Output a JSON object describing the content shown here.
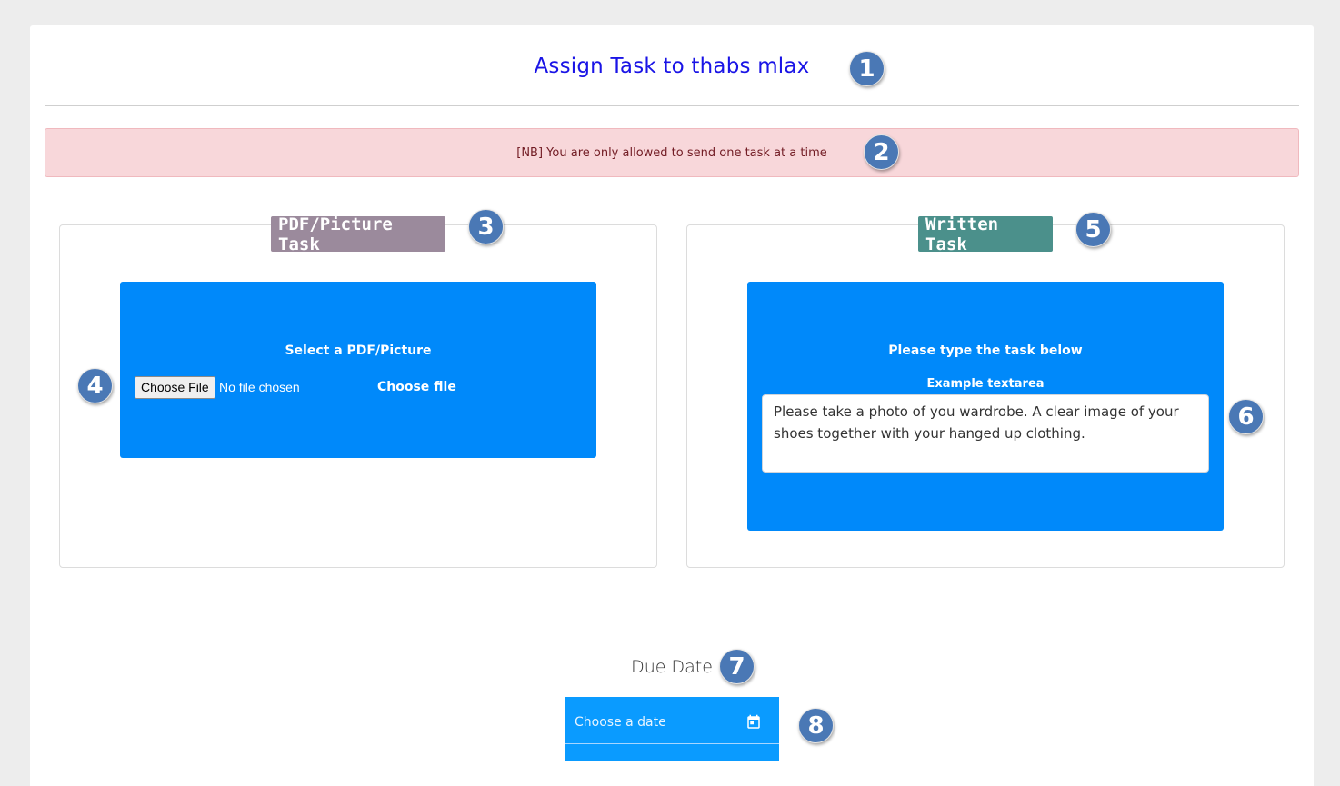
{
  "header": {
    "title": "Assign Task to thabs mlax"
  },
  "alert": {
    "text": "[NB] You are only allowed to send one task at a time"
  },
  "pdf_task": {
    "chip_label": "PDF/Picture Task",
    "heading": "Select a PDF/Picture",
    "file_button_label": "Choose File",
    "file_status": "No file chosen",
    "choose_file_label": "Choose file"
  },
  "written_task": {
    "chip_label": "Written Task",
    "heading": "Please type the task below",
    "textarea_label": "Example textarea",
    "textarea_value": "Please take a photo of you wardrobe. A clear image of your shoes together with your hanged up clothing."
  },
  "due_date": {
    "label": "Due Date",
    "placeholder": "Choose a date",
    "icon": "calendar-icon"
  },
  "markers": [
    "1",
    "2",
    "3",
    "4",
    "5",
    "6",
    "7",
    "8"
  ],
  "colors": {
    "page_bg": "#ededed",
    "title": "#1a14e6",
    "alert_bg": "#f8d7da",
    "alert_text": "#721c24",
    "pdf_chip": "#9b8a9c",
    "written_chip": "#4b908b",
    "blue_box": "#0089fa",
    "date_field": "#0a9bff",
    "marker": "#4a78b5"
  }
}
